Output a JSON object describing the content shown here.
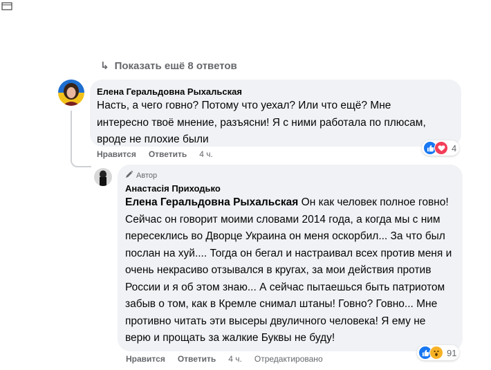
{
  "more_replies": {
    "label": "Показать ещё 8 ответов"
  },
  "comments": [
    {
      "author": "Елена Геральдовна Рыхальская",
      "text": "Насть, а чего говно? Потому что уехал? Или что ещё? Мне интересно твоё мнение, разъясни! Я с ними работала по плюсам, вроде не плохие были",
      "like_label": "Нравится",
      "reply_label": "Ответить",
      "time": "4 ч.",
      "reaction_count": "4"
    },
    {
      "badge": "Автор",
      "author": "Анастасія Приходько",
      "mention": "Елена Геральдовна Рыхальская",
      "text": " Он как человек полное говно! Сейчас он говорит моими словами 2014 года, а когда мы с ним пересеклись во Дворце Украина он меня оскорбил... За что был послан на хуй.... Тогда он бегал и настраивал всех против меня и очень некрасиво отзывался в кругах, за мои действия против России и я об этом знаю... А сейчас пытаешься быть патриотом забыв о том, как в Кремле снимал штаны! Говно? Говно... Мне противно читать эти высеры двуличного человека! Я ему не верю и прощать за жалкие Буквы не буду!",
      "like_label": "Нравится",
      "reply_label": "Ответить",
      "time": "4 ч.",
      "edited": "Отредактировано",
      "reaction_count": "91"
    }
  ],
  "colors": {
    "bubble": "#f0f2f5",
    "secondary_text": "#65676b",
    "like_blue": "#1877f2",
    "love_red": "#f33e58",
    "wow_yellow": "#f7b125"
  }
}
